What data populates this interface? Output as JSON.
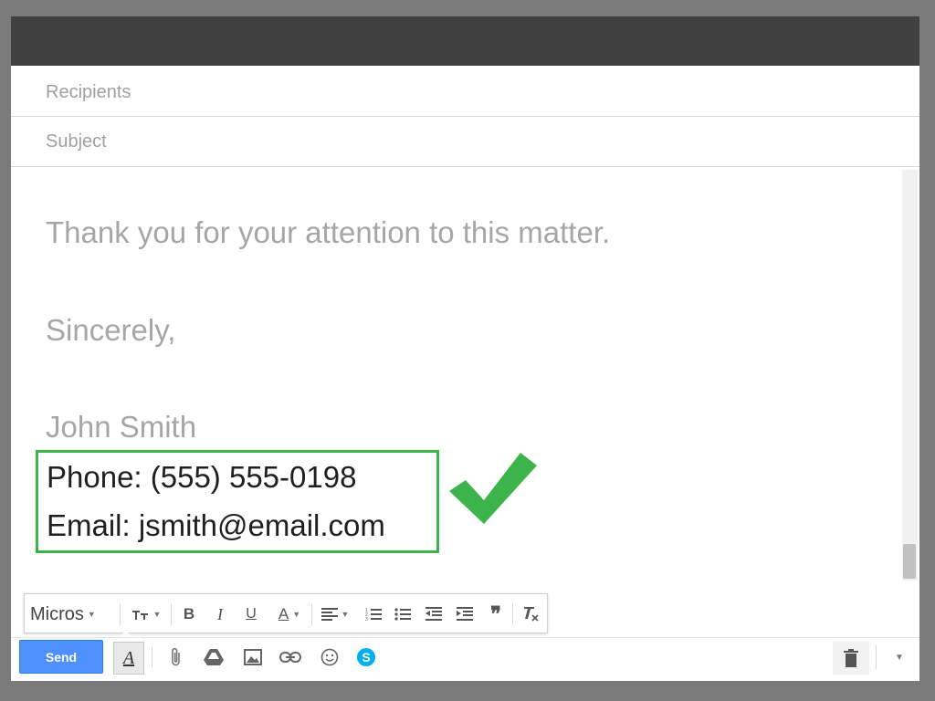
{
  "compose": {
    "recipients_placeholder": "Recipients",
    "subject_placeholder": "Subject",
    "body": {
      "line_thanks": "Thank you for your attention to this matter.",
      "line_sincerely": "Sincerely,",
      "line_name": "John Smith",
      "signature_phone": "Phone: (555) 555-0198",
      "signature_email": "Email: jsmith@email.com"
    }
  },
  "format_toolbar": {
    "font_value": "Micros",
    "size_icon": "text-size-icon",
    "bold_label": "B",
    "italic_label": "I",
    "underline_label": "U",
    "text_color_label": "A",
    "align_icon": "align-left-icon",
    "numbered_list_icon": "numbered-list-icon",
    "bulleted_list_icon": "bulleted-list-icon",
    "outdent_icon": "outdent-icon",
    "indent_icon": "indent-icon",
    "quote_label": "❞",
    "clear_format_icon": "remove-formatting-icon"
  },
  "bottom_bar": {
    "send_label": "Send",
    "format_toggle_label": "A",
    "icons": [
      "paperclip-icon",
      "drive-icon",
      "photo-icon",
      "link-icon",
      "emoji-icon",
      "skype-icon",
      "trash-icon",
      "chevron-down-icon"
    ]
  },
  "colors": {
    "titlebar": "#404040",
    "send_button": "#4d90fe",
    "highlight_box": "#3cb44b",
    "check_mark": "#3cb44b",
    "faded_text": "#a6a6a6"
  }
}
